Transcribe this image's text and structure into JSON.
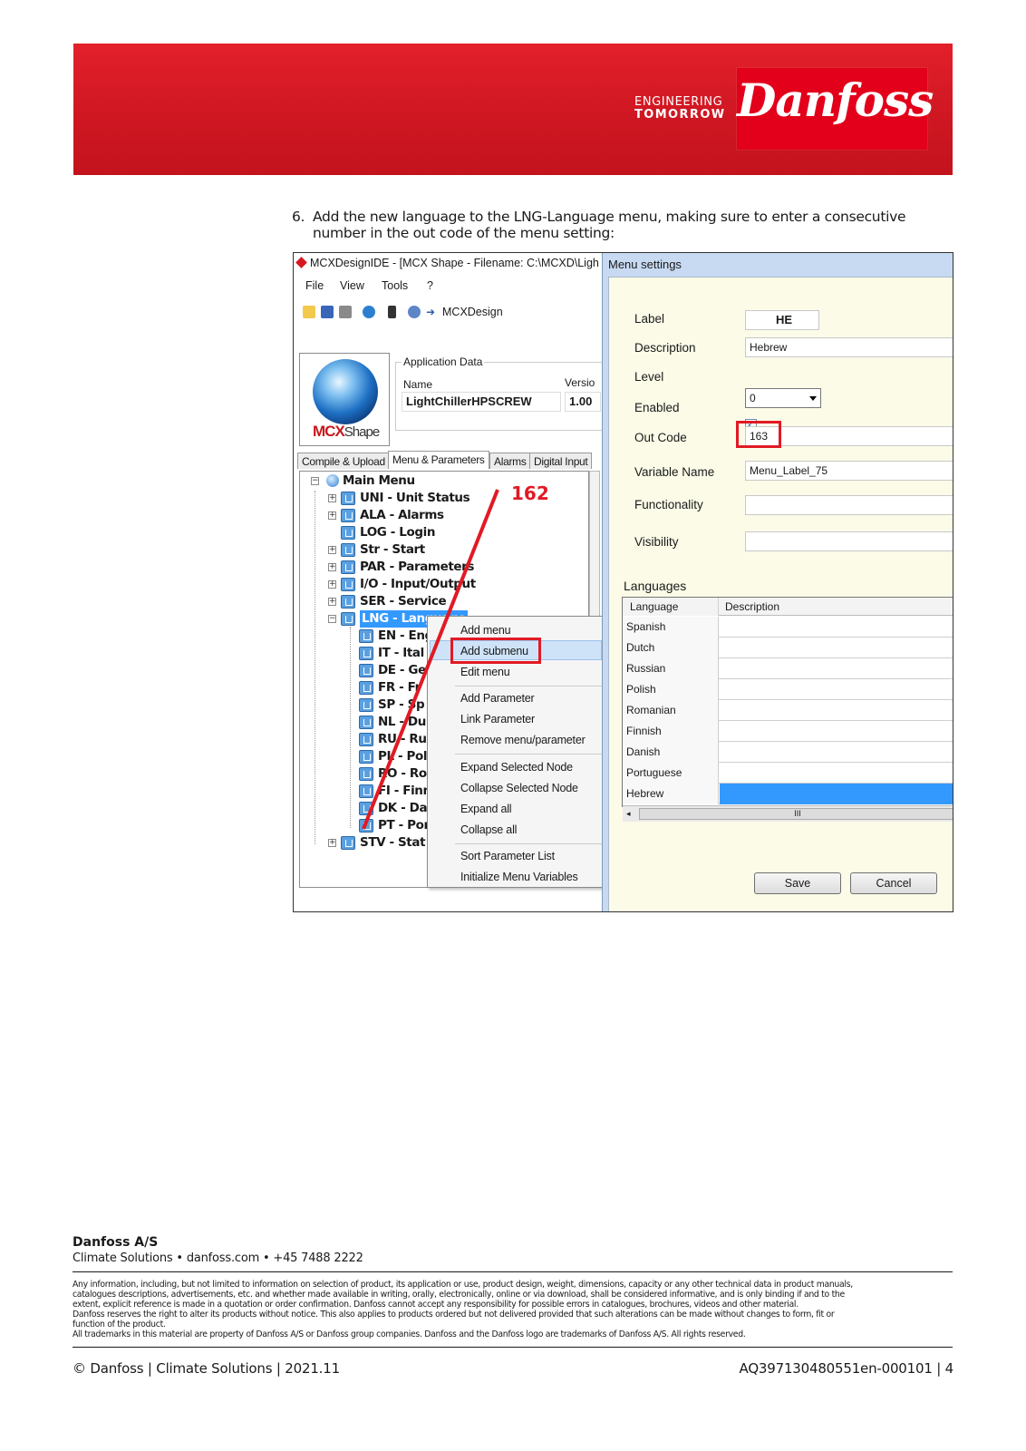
{
  "header": {
    "slogan_line1": "ENGINEERING",
    "slogan_line2": "TOMORROW",
    "brand_logo": "Danfoss",
    "brand_color": "#e2001a"
  },
  "instruction": {
    "number": "6.",
    "text": "Add the new language to the LNG-Language menu, making sure to enter a consecutive number in the out code of the menu setting:"
  },
  "ide": {
    "title": "MCXDesignIDE - [MCX Shape  -  Filename: C:\\MCXD\\Ligh",
    "menu": [
      "File",
      "View",
      "Tools",
      "?"
    ],
    "toolbar_label": "MCXDesign",
    "logo_text": "MCX",
    "logo_text2": "Shape",
    "app_data": {
      "legend": "Application Data",
      "name_label": "Name",
      "version_label": "Versio",
      "name_value": "LightChillerHPSCREW",
      "version_value": "1.00"
    },
    "tabs": [
      "Compile & Upload",
      "Menu & Parameters",
      "Alarms",
      "Digital Input"
    ],
    "tree": {
      "root": "Main Menu",
      "top_items": [
        "UNI - Unit Status",
        "ALA - Alarms",
        "LOG - Login",
        "Str - Start",
        "PAR - Parameters",
        "I/O - Input/Output",
        "SER - Service",
        "LNG - Language"
      ],
      "lang_items": [
        "EN - Eng",
        "IT - Ital",
        "DE - Ge",
        "FR - Fr",
        "SP - Sp",
        "NL - Du",
        "RU - Ru",
        "PL - Pol",
        "RO - Ro",
        "FI - Finn",
        "DK - Da",
        "PT - Por"
      ],
      "last_item": "STV - Stat"
    },
    "annotation": "162",
    "context_menu": [
      "Add menu",
      "Add submenu",
      "Edit menu",
      "Add Parameter",
      "Link Parameter",
      "Remove menu/parameter",
      "Expand Selected Node",
      "Collapse Selected Node",
      "Expand all",
      "Collapse all",
      "Sort Parameter List",
      "Initialize Menu Variables"
    ]
  },
  "dialog": {
    "title": "Menu settings",
    "fields": {
      "label_label": "Label",
      "label_value": "HE",
      "description_label": "Description",
      "description_value": "Hebrew",
      "level_label": "Level",
      "level_value": "0",
      "enabled_label": "Enabled",
      "enabled_checked": true,
      "outcode_label": "Out Code",
      "outcode_value": "163",
      "varname_label": "Variable Name",
      "varname_value": "Menu_Label_75",
      "functionality_label": "Functionality",
      "visibility_label": "Visibility"
    },
    "languages_heading": "Languages",
    "grid_headers": [
      "Language",
      "Description"
    ],
    "languages": [
      "Spanish",
      "Dutch",
      "Russian",
      "Polish",
      "Romanian",
      "Finnish",
      "Danish",
      "Portuguese",
      "Hebrew"
    ],
    "scroll_mark": "III",
    "save_label": "Save",
    "cancel_label": "Cancel"
  },
  "footer": {
    "company": "Danfoss A/S",
    "contact": "Climate Solutions • danfoss.com • +45 7488 2222",
    "disclaimer": [
      "Any information, including, but not limited to information on selection of product, its application or use, product design, weight, dimensions, capacity or any other technical data in product manuals,",
      "catalogues descriptions, advertisements, etc. and whether made available in writing, orally, electronically, online or via download, shall be considered informative, and is only binding if and to the",
      "extent, explicit reference is made in a quotation or order confirmation. Danfoss cannot accept any responsibility for possible errors in catalogues, brochures, videos and other material.",
      "Danfoss reserves the right to alter its products without notice. This also applies to products ordered but not delivered provided that such alterations can be made without changes to form, fit or",
      "function of the product.",
      "All trademarks in this material are property of Danfoss A/S or Danfoss group companies. Danfoss and the Danfoss logo are trademarks of Danfoss A/S. All rights reserved."
    ],
    "left": "© Danfoss | Climate Solutions | 2021.11",
    "right": "AQ397130480551en-000101 | 4"
  }
}
